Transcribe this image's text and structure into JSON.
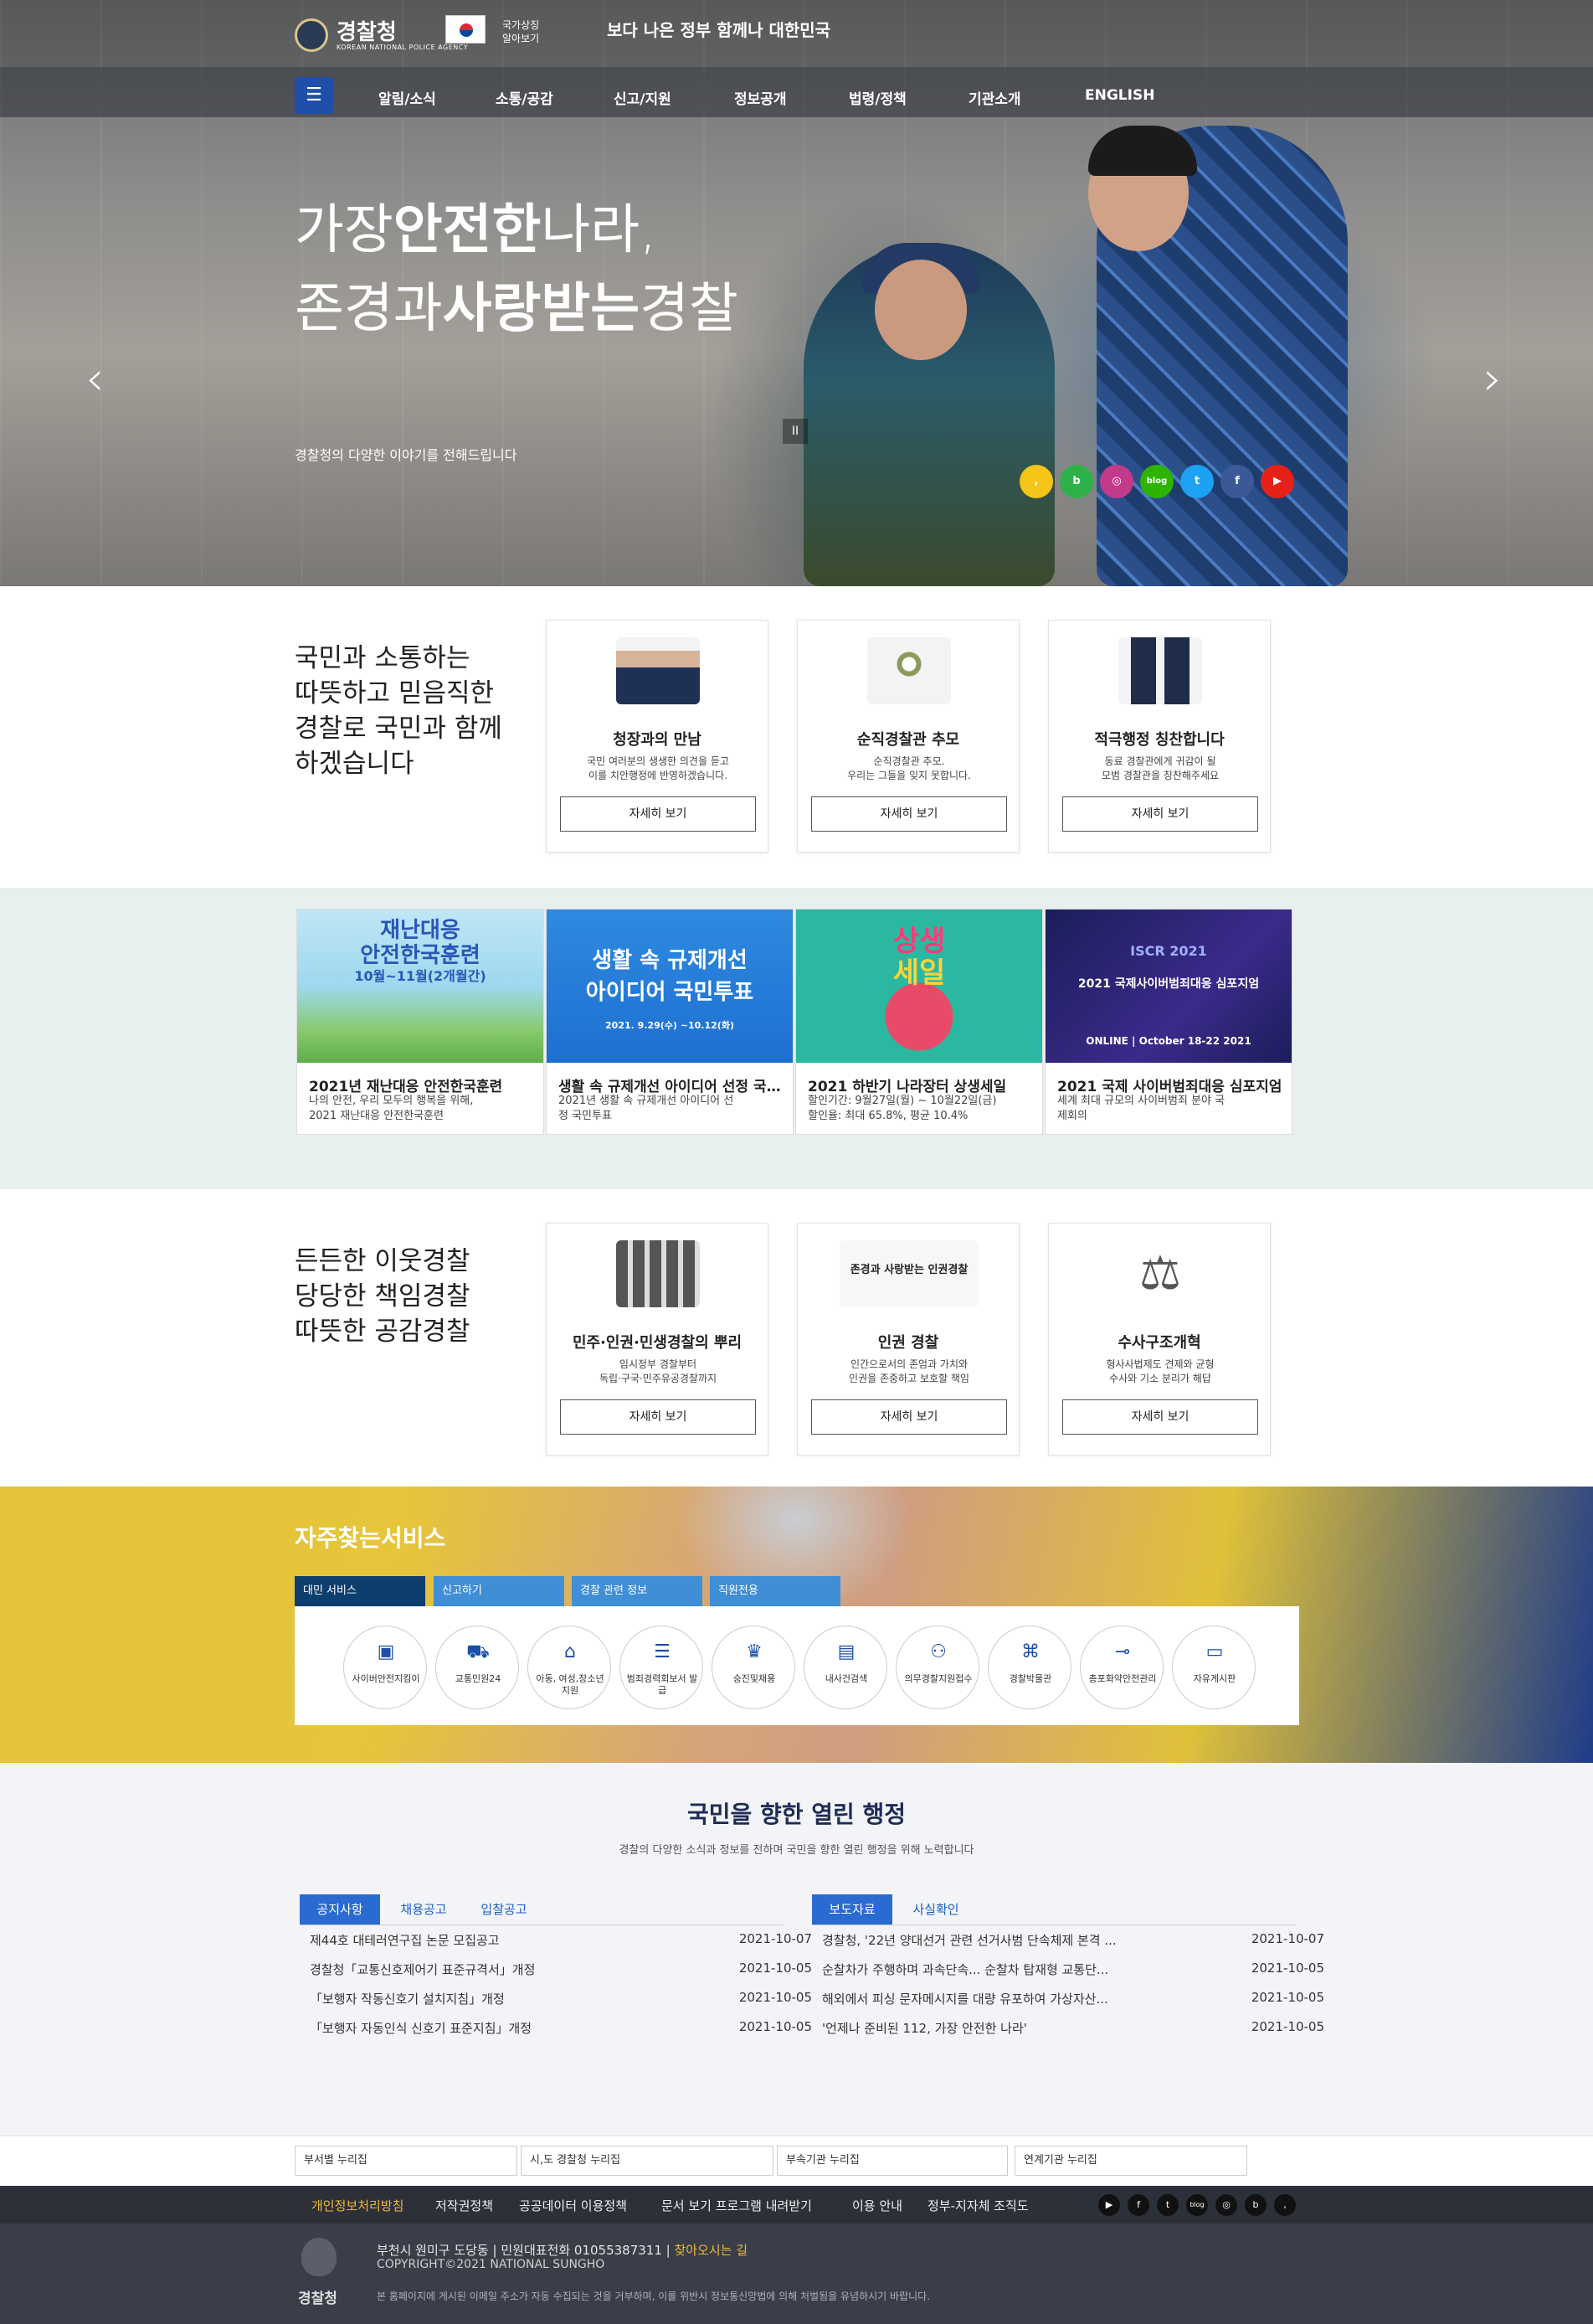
{
  "header": {
    "logo_text": "경찰청",
    "logo_sub": "KOREAN NATIONAL POLICE AGENCY",
    "flag_label_1": "국가상징",
    "flag_label_2": "알아보기",
    "slogan": "보다 나은 정부 함께나 대한민국",
    "nav": [
      "알림/소식",
      "소통/공감",
      "신고/지원",
      "정보공개",
      "법령/정책",
      "기관소개",
      "ENGLISH"
    ]
  },
  "hero": {
    "line1_pre": "가장",
    "line1_bold": "안전한",
    "line1_post": "나라,",
    "line2_pre": "존경과",
    "line2_bold": "사랑받는",
    "line2_post": "경찰",
    "subtitle": "경찰청의 다양한 이야기를 전해드립니다",
    "prev": "‹",
    "next": "›",
    "pause": "II",
    "sns": [
      {
        "name": "kakao",
        "glyph": ",",
        "color": "#f5c518"
      },
      {
        "name": "band",
        "glyph": "b",
        "color": "#2fb14a"
      },
      {
        "name": "instagram",
        "glyph": "◎",
        "color": "#c43a8a"
      },
      {
        "name": "blog",
        "glyph": "blog",
        "color": "#2db400"
      },
      {
        "name": "twitter",
        "glyph": "t",
        "color": "#1da1f2"
      },
      {
        "name": "facebook",
        "glyph": "f",
        "color": "#3b5998"
      },
      {
        "name": "youtube",
        "glyph": "▶",
        "color": "#e62117"
      }
    ]
  },
  "section1": {
    "title": [
      "국민과 소통하는",
      "따뜻하고 믿음직한",
      "경찰로 국민과 함께",
      "하겠습니다"
    ],
    "cards": [
      {
        "title": "청장과의 만남",
        "desc1": "국민 여러분의 생생한 의견을 듣고",
        "desc2": "이를 치안행정에 반영하겠습니다.",
        "button": "자세히 보기"
      },
      {
        "title": "순직경찰관 추모",
        "desc1": "순직경찰관 추모.",
        "desc2": "우리는 그들을 잊지 못합니다.",
        "button": "자세히 보기"
      },
      {
        "title": "적극행정 칭찬합니다",
        "desc1": "동료 경찰관에게 귀감이 될",
        "desc2": "모범 경찰관을 칭찬해주세요",
        "button": "자세히 보기"
      }
    ]
  },
  "banners": [
    {
      "img_l1": "재난대응",
      "img_l2": "안전한국훈련",
      "img_l3": "10월~11월(2개월간)",
      "title": "2021년 재난대응 안전한국훈련",
      "desc1": "나의 안전, 우리 모두의 행복을 위해,",
      "desc2": "2021 재난대응 안전한국훈련"
    },
    {
      "img_l1": "생활 속 규제개선",
      "img_l2": "아이디어 국민투표",
      "img_l3": "2021. 9.29(수) ~10.12(화)",
      "title": "생활 속 규제개선 아이디어 선정 국민투표",
      "desc1": "2021년 생활 속 규제개선 아이디어 선",
      "desc2": "정 국민투표"
    },
    {
      "img_l1": "상생",
      "img_l2": "세일",
      "img_l3": "",
      "title": "2021 하반기 나라장터 상생세일",
      "desc1": "할인기간: 9월27일(월) ~ 10월22일(금)",
      "desc2": "할인율: 최대 65.8%, 평균 10.4%"
    },
    {
      "img_l1": "ISCR 2021",
      "img_l2": "2021 국제사이버범죄대응 심포지엄",
      "img_l3": "ONLINE | October 18-22 2021",
      "title": "2021 국제 사이버범죄대응 심포지엄",
      "desc1": "세계 최대 규모의 사이버범죄 분야 국",
      "desc2": "제회의"
    }
  ],
  "section2": {
    "title": [
      "든든한 이웃경찰",
      "당당한 책임경찰",
      "따뜻한 공감경찰"
    ],
    "cards": [
      {
        "title": "민주·인권·민생경찰의 뿌리",
        "desc1": "임시정부 경찰부터",
        "desc2": "독립·구국·민주유공경찰까지",
        "button": "자세히 보기"
      },
      {
        "title": "인권 경찰",
        "desc1": "인간으로서의 존엄과 가치와",
        "desc2": "인권을 존중하고 보호할 책임",
        "button": "자세히 보기"
      },
      {
        "title": "수사구조개혁",
        "desc1": "형사사법제도 견제와 균형",
        "desc2": "수사와 기소 분리가 해답",
        "button": "자세히 보기"
      }
    ],
    "card2_art": "존경과 사랑받는 인권경찰"
  },
  "services": {
    "title": "자주찾는서비스",
    "tabs": [
      "대민 서비스",
      "신고하기",
      "경찰 관련 정보",
      "직원전용"
    ],
    "items": [
      {
        "icon": "monitor-icon",
        "glyph": "▣",
        "label": "사이버안전지킴이"
      },
      {
        "icon": "car-icon",
        "glyph": "⛟",
        "label": "교통민원24"
      },
      {
        "icon": "house-heart-icon",
        "glyph": "⌂",
        "label": "아동, 여성,장소년 지원"
      },
      {
        "icon": "document-icon",
        "glyph": "☰",
        "label": "범죄경력회보서 발급"
      },
      {
        "icon": "trophy-icon",
        "glyph": "♛",
        "label": "승진및채용"
      },
      {
        "icon": "id-card-icon",
        "glyph": "▤",
        "label": "내사건검색"
      },
      {
        "icon": "people-icon",
        "glyph": "⚇",
        "label": "의무경찰지원접수"
      },
      {
        "icon": "museum-icon",
        "glyph": "⌘",
        "label": "경찰박물관"
      },
      {
        "icon": "gun-icon",
        "glyph": "⊸",
        "label": "총포화약안전관리"
      },
      {
        "icon": "board-icon",
        "glyph": "▭",
        "label": "자유게시판"
      }
    ]
  },
  "open_admin": {
    "title": "국민을 향한 열린 행정",
    "subtitle": "경찰의 다양한 소식과 정보를 전하며 국민을 향한 열린 행정을 위해 노력합니다",
    "left_tabs": [
      "공지사항",
      "채용공고",
      "입찰공고"
    ],
    "right_tabs": [
      "보도자료",
      "사실확인"
    ],
    "left_news": [
      {
        "title": "제44호 대테러연구집 논문 모집공고",
        "date": "2021-10-07"
      },
      {
        "title": "경찰청「교통신호제어기 표준규격서」개정",
        "date": "2021-10-05"
      },
      {
        "title": "「보행자 작동신호기 설치지침」개정",
        "date": "2021-10-05"
      },
      {
        "title": "「보행자 자동인식 신호기 표준지침」개정",
        "date": "2021-10-05"
      }
    ],
    "right_news": [
      {
        "title": "경찰청, '22년 양대선거 관련 선거사범 단속체제 본격 ...",
        "date": "2021-10-07"
      },
      {
        "title": "순찰차가 주행하며 과속단속... 순찰차 탑재형 교통단...",
        "date": "2021-10-05"
      },
      {
        "title": "해외에서 피싱 문자메시지를 대량 유포하여 가상자산...",
        "date": "2021-10-05"
      },
      {
        "title": "'언제나 준비된 112, 가장 안전한 나라'",
        "date": "2021-10-05"
      }
    ]
  },
  "links": [
    "부서별 누리집",
    "시,도 경찰청 누리집",
    "부속기관 누리집",
    "연계기관 누리집"
  ],
  "footer": {
    "menu": [
      "개인정보처리방침",
      "저작권정책",
      "공공데이터 이용정책",
      "문서 보기 프로그램 내려받기",
      "이용 안내",
      "정부-지자체 조직도"
    ],
    "social": [
      "▶",
      "f",
      "t",
      "blog",
      "◎",
      "b",
      ","
    ],
    "address": "부천시 원미구 도당동",
    "phone": "민원대표전화 01055387311",
    "directions": "찾아오시는 길",
    "copyright": "COPYRIGHT©2021 NATIONAL SUNGHO",
    "notice": "본 홈페이지에 게시된 이메일 주소가 자동 수집되는 것을 거부하며, 이를 위반시 정보통신망법에 의해 처벌됨을 유념하시기 바랍니다.",
    "logo_text": "경찰청"
  },
  "colors": {
    "primary": "#1f4fa8",
    "accent": "#f0b93a",
    "service_tab": "#1b5a96"
  }
}
